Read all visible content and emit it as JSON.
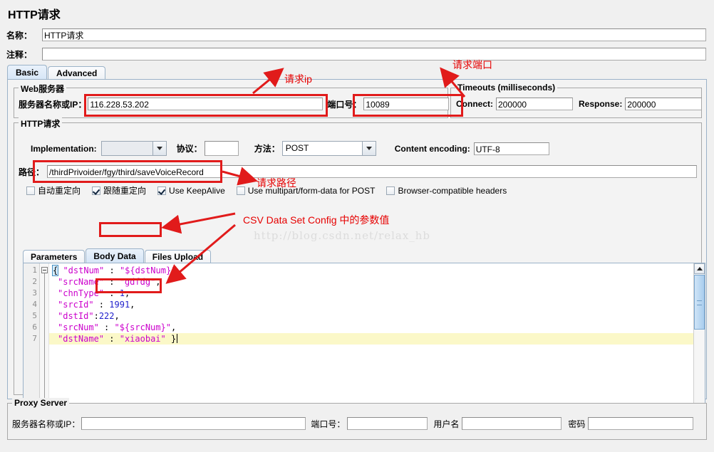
{
  "window": {
    "title": "HTTP请求"
  },
  "header": {
    "name_label": "名称：",
    "name_value": "HTTP请求",
    "comment_label": "注释：",
    "comment_value": ""
  },
  "tabs": [
    {
      "label": "Basic",
      "active": true
    },
    {
      "label": "Advanced",
      "active": false
    }
  ],
  "web_server": {
    "group_title": "Web服务器",
    "server_label": "服务器名称或IP：",
    "server_value": "116.228.53.202",
    "port_label": "端口号：",
    "port_value": "10089"
  },
  "timeouts": {
    "group_title": "Timeouts (milliseconds)",
    "connect_label": "Connect:",
    "connect_value": "200000",
    "response_label": "Response:",
    "response_value": "200000"
  },
  "http_request": {
    "group_title": "HTTP请求",
    "implementation_label": "Implementation:",
    "implementation_value": "",
    "protocol_label": "协议：",
    "protocol_value": "",
    "method_label": "方法：",
    "method_value": "POST",
    "content_encoding_label": "Content encoding:",
    "content_encoding_value": "UTF-8",
    "path_label": "路径：",
    "path_value": "/thirdPrivoider/fgy/third/saveVoiceRecord",
    "checkboxes": [
      {
        "label": "自动重定向",
        "checked": false
      },
      {
        "label": "跟随重定向",
        "checked": true
      },
      {
        "label": "Use KeepAlive",
        "checked": true
      },
      {
        "label": "Use multipart/form-data for POST",
        "checked": false
      },
      {
        "label": "Browser-compatible headers",
        "checked": false
      }
    ]
  },
  "body_tabs": [
    {
      "label": "Parameters",
      "active": false
    },
    {
      "label": "Body Data",
      "active": true
    },
    {
      "label": "Files Upload",
      "active": false
    }
  ],
  "editor": {
    "line_numbers": [
      "1",
      "2",
      "3",
      "4",
      "5",
      "6",
      "7"
    ],
    "lines": [
      {
        "indent": 0,
        "tokens": [
          {
            "t": "{",
            "c": "brace"
          },
          {
            "t": " \"dstNum\"",
            "c": "k"
          },
          {
            "t": " : ",
            "c": "p"
          },
          {
            "t": "\"${dstNum}\"",
            "c": "s"
          },
          {
            "t": ",",
            "c": "p"
          }
        ]
      },
      {
        "indent": 1,
        "tokens": [
          {
            "t": "\"srcName\"",
            "c": "k"
          },
          {
            "t": " : ",
            "c": "p"
          },
          {
            "t": "\"gdfdg\"",
            "c": "s"
          },
          {
            "t": ",",
            "c": "p"
          }
        ]
      },
      {
        "indent": 1,
        "tokens": [
          {
            "t": "\"chnType\"",
            "c": "k"
          },
          {
            "t": " : ",
            "c": "p"
          },
          {
            "t": "1",
            "c": "n"
          },
          {
            "t": ",",
            "c": "p"
          }
        ]
      },
      {
        "indent": 1,
        "tokens": [
          {
            "t": "\"srcId\"",
            "c": "k"
          },
          {
            "t": " : ",
            "c": "p"
          },
          {
            "t": "1991",
            "c": "n"
          },
          {
            "t": ",",
            "c": "p"
          }
        ]
      },
      {
        "indent": 1,
        "tokens": [
          {
            "t": "\"dstId\"",
            "c": "k"
          },
          {
            "t": ":",
            "c": "p"
          },
          {
            "t": "222",
            "c": "n"
          },
          {
            "t": ",",
            "c": "p"
          }
        ]
      },
      {
        "indent": 1,
        "tokens": [
          {
            "t": "\"srcNum\"",
            "c": "k"
          },
          {
            "t": " : ",
            "c": "p"
          },
          {
            "t": "\"${srcNum}\"",
            "c": "s"
          },
          {
            "t": ",",
            "c": "p"
          }
        ]
      },
      {
        "indent": 1,
        "highlight": true,
        "tokens": [
          {
            "t": "\"dstName\"",
            "c": "k"
          },
          {
            "t": " : ",
            "c": "p"
          },
          {
            "t": "\"xiaobai\"",
            "c": "s"
          },
          {
            "t": " }",
            "c": "p"
          }
        ]
      }
    ]
  },
  "proxy_server": {
    "group_title": "Proxy Server",
    "server_label": "服务器名称或IP：",
    "server_value": "",
    "port_label": "端口号：",
    "port_value": "",
    "user_label": "用户名",
    "user_value": "",
    "password_label": "密码",
    "password_value": ""
  },
  "watermark": {
    "text": "http://blog.csdn.net/relax_hb"
  },
  "annotations": [
    {
      "text": "请求ip"
    },
    {
      "text": "请求端口"
    },
    {
      "text": "请求路径"
    },
    {
      "text": "CSV Data Set Config 中的参数值"
    }
  ],
  "colors": {
    "annotation_red": "#e11b1b",
    "accent_blue": "#9bb2c8",
    "highlight_yellow": "#fbf8c8",
    "json_key": "#cc00cc",
    "json_number": "#2222cc"
  }
}
